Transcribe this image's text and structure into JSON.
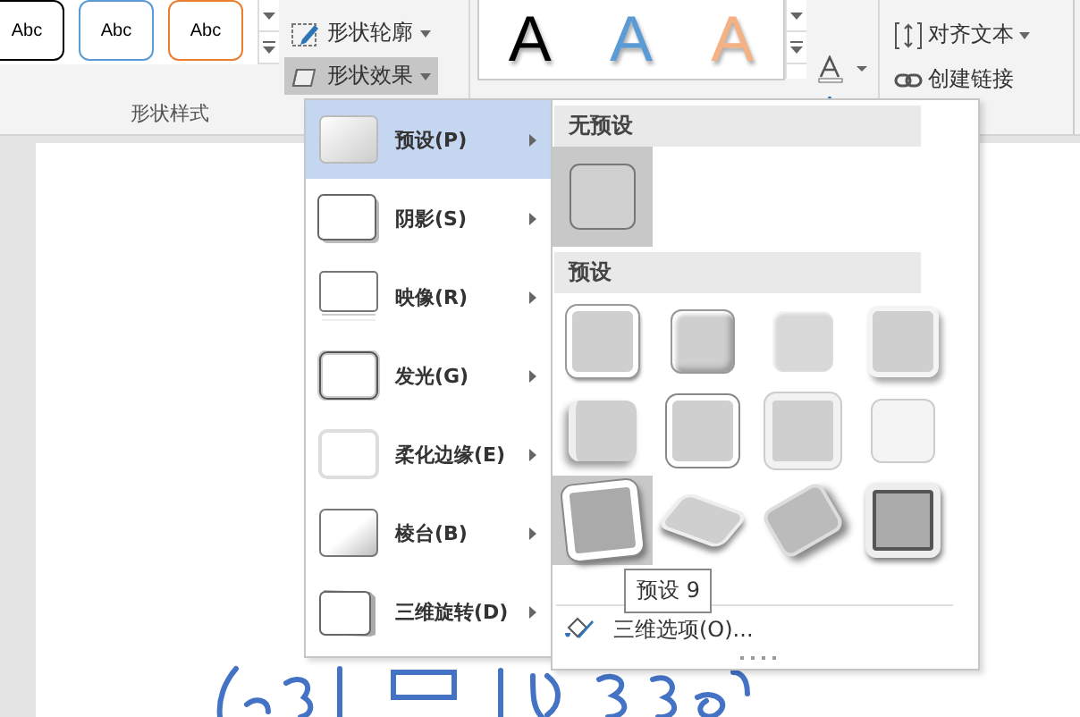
{
  "ribbon": {
    "shape_styles": [
      {
        "label": "Abc",
        "color": "#000000"
      },
      {
        "label": "Abc",
        "color": "#5b9bd5"
      },
      {
        "label": "Abc",
        "color": "#ed7d31"
      }
    ],
    "shape_buttons": [
      {
        "label": "形状轮廓",
        "selected": false
      },
      {
        "label": "形状效果",
        "selected": true
      }
    ],
    "group_label": "形状样式",
    "wordart_styles": [
      {
        "label": "A",
        "color": "#000000"
      },
      {
        "label": "A",
        "color": "#5b9bd5"
      },
      {
        "label": "A",
        "color": "#f4b183"
      }
    ],
    "text_buttons": [
      {
        "label": "对齐文本"
      },
      {
        "label": "创建链接"
      }
    ]
  },
  "effects_menu": {
    "items": [
      {
        "label": "预设(P)",
        "kind": "preset",
        "selected": true
      },
      {
        "label": "阴影(S)",
        "kind": "shadow",
        "selected": false
      },
      {
        "label": "映像(R)",
        "kind": "reflection",
        "selected": false
      },
      {
        "label": "发光(G)",
        "kind": "glow",
        "selected": false
      },
      {
        "label": "柔化边缘(E)",
        "kind": "soft",
        "selected": false
      },
      {
        "label": "棱台(B)",
        "kind": "bevel",
        "selected": false
      },
      {
        "label": "三维旋转(D)",
        "kind": "rotation",
        "selected": false
      }
    ]
  },
  "preset_submenu": {
    "no_preset_header": "无预设",
    "preset_header": "预设",
    "presets": [
      {
        "selected": false
      },
      {
        "selected": false
      },
      {
        "selected": false
      },
      {
        "selected": false
      },
      {
        "selected": false
      },
      {
        "selected": false
      },
      {
        "selected": false
      },
      {
        "selected": false
      },
      {
        "selected": true
      },
      {
        "selected": false
      },
      {
        "selected": false
      },
      {
        "selected": false
      }
    ],
    "tooltip": "预设 9",
    "options_link": "三维选项(O)..."
  }
}
